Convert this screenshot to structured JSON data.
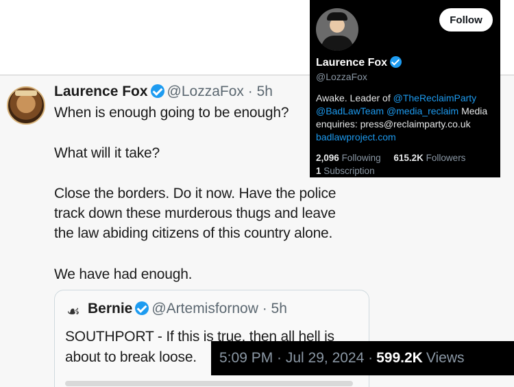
{
  "tweet": {
    "author_name": "Laurence Fox",
    "author_meta": "@LozzaFox · 5h",
    "lines": [
      "When is enough going to be enough?",
      "What will it take?",
      "Close the borders. Do it now. Have the police",
      "track down these murderous thugs and leave",
      "the law abiding citizens of this country alone.",
      "We have had enough."
    ]
  },
  "quote": {
    "author_name": "Bernie",
    "author_meta": "@Artemisfornow · 5h",
    "lines": [
      "SOUTHPORT - If this is true, then all hell is",
      "about to break loose."
    ]
  },
  "profile": {
    "follow_label": "Follow",
    "name": "Laurence Fox",
    "handle": "@LozzaFox",
    "bio_line1_text": "Awake. Leader of ",
    "bio_line1_link": "@TheReclaimParty",
    "bio_line2_link1": "@BadLawTeam",
    "bio_line2_link2": "@media_reclaim",
    "bio_line2_text": " Media",
    "bio_line3": "enquiries: press@reclaimparty.co.uk",
    "website": "badlawproject.com",
    "following_count": "2,096",
    "following_label": "Following",
    "followers_count": "615.2K",
    "followers_label": "Followers",
    "subscription_count": "1",
    "subscription_label": "Subscription"
  },
  "timestamp": {
    "time_date": "5:09 PM · Jul 29, 2024 ·",
    "views_count": "599.2K",
    "views_label": "Views"
  },
  "colors": {
    "verified": "#1d9bf0",
    "link": "#1d9bf0",
    "dark_bg": "#000000"
  }
}
